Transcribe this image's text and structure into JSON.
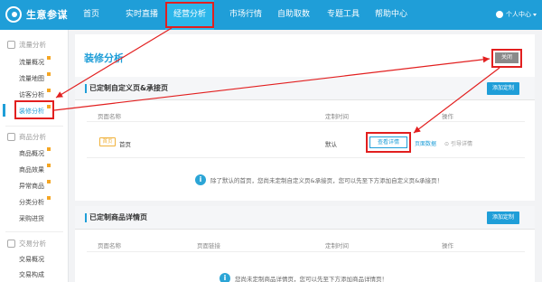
{
  "app": {
    "name": "生意参谋"
  },
  "nav": {
    "items": [
      {
        "label": "首页"
      },
      {
        "label": "实时直播"
      },
      {
        "label": "经营分析"
      },
      {
        "label": "市场行情"
      },
      {
        "label": "自助取数"
      },
      {
        "label": "专题工具"
      },
      {
        "label": "帮助中心"
      }
    ],
    "user_label": "个人中心"
  },
  "sidebar": {
    "groups": [
      {
        "title": "流量分析"
      },
      {
        "title": "商品分析"
      },
      {
        "title": "交易分析"
      }
    ],
    "items": [
      {
        "label": "流量概况"
      },
      {
        "label": "流量地图"
      },
      {
        "label": "访客分析"
      },
      {
        "label": "装修分析"
      },
      {
        "label": "商品概况"
      },
      {
        "label": "商品效果"
      },
      {
        "label": "异常商品"
      },
      {
        "label": "分类分析"
      },
      {
        "label": "采购进货"
      },
      {
        "label": "交易概况"
      },
      {
        "label": "交易构成"
      }
    ]
  },
  "page": {
    "title": "装修分析",
    "top_button": "关闭"
  },
  "section1": {
    "title": "已定制自定义页&承接页",
    "add_button": "添加定制",
    "columns": [
      "页面名称",
      "定制时间",
      "操作"
    ],
    "row": {
      "tag": "首页",
      "name": "首页",
      "time": "默认",
      "view_button": "查看详情",
      "link1": "页面数据",
      "link2": "引导详情"
    },
    "info": "除了默认的首页，您尚未定制自定义页&承接页，您可以先至下方添加自定义页&承接页！"
  },
  "section2": {
    "title": "已定制商品详情页",
    "add_button": "添加定制",
    "columns": [
      "页面名称",
      "页面链接",
      "定制时间",
      "操作"
    ],
    "info": "您尚未定制商品详情页，您可以先至下方添加商品详情页！"
  },
  "colors": {
    "brand": "#1f9ed8",
    "annotation": "#e21f1f",
    "tag": "#f0b23c"
  }
}
